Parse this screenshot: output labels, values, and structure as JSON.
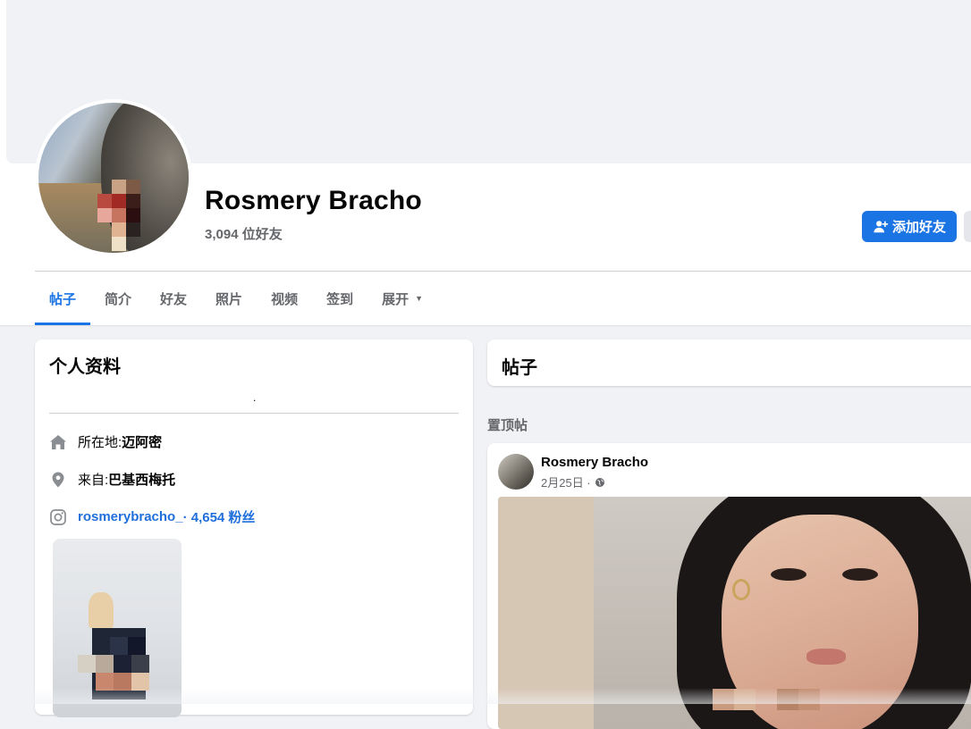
{
  "profile": {
    "name": "Rosmery Bracho",
    "friends_count": "3,094 位好友",
    "add_friend_label": "添加好友"
  },
  "tabs": [
    {
      "label": "帖子",
      "active": true
    },
    {
      "label": "简介"
    },
    {
      "label": "好友"
    },
    {
      "label": "照片"
    },
    {
      "label": "视频"
    },
    {
      "label": "签到"
    },
    {
      "label": "展开"
    }
  ],
  "intro": {
    "title": "个人资料",
    "bio": ".",
    "location_label": "所在地:",
    "location_value": "迈阿密",
    "from_label": "来自:",
    "from_value": "巴基西梅托",
    "instagram_handle": "rosmerybracho_",
    "instagram_followers": " · 4,654 粉丝"
  },
  "posts": {
    "title": "帖子",
    "pinned_label": "置顶帖",
    "pinned_post": {
      "author": "Rosmery Bracho",
      "date": "2月25日 ·",
      "audience_icon": "globe-icon"
    }
  },
  "colors": {
    "accent": "#1b74e4",
    "page_bg": "#f0f2f5",
    "link": "#216fdb",
    "secondary_text": "#65676b"
  }
}
